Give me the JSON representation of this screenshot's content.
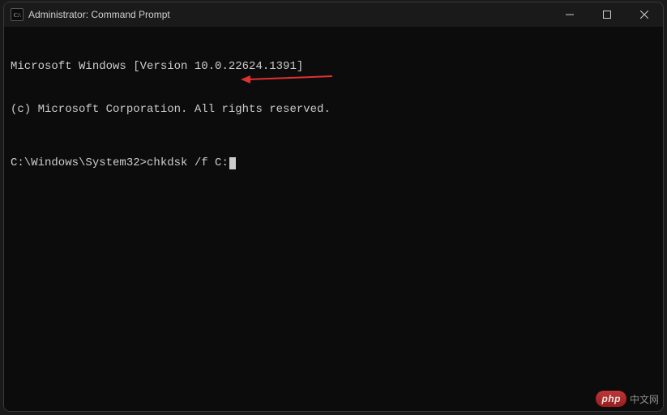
{
  "window": {
    "title": "Administrator: Command Prompt"
  },
  "terminal": {
    "line1": "Microsoft Windows [Version 10.0.22624.1391]",
    "line2": "(c) Microsoft Corporation. All rights reserved.",
    "prompt": "C:\\Windows\\System32>",
    "command": "chkdsk /f C:"
  },
  "watermark": {
    "badge": "php",
    "text": "中文网"
  }
}
